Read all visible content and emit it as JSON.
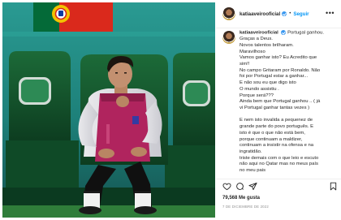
{
  "header": {
    "username": "katiaaveirooficial",
    "dot": "•",
    "follow_label": "Seguir",
    "more_label": "•••"
  },
  "caption": {
    "username": "katiaaveirooficial",
    "first_text": "Portugal ganhou.",
    "lines": [
      "Graças a Deus.",
      "Novos talentos brilharam.",
      "Maravilhoso",
      "Vamos ganhar isto? Eu Acredito que",
      "sim!!",
      "No campo Gritaram por Ronaldo. Não",
      "foi por Portugal estar a ganhar...",
      "E não sou eu que digo isto",
      "O mundo assistiu .",
      "Porque será???",
      "Ainda bem que Portugal ganhou .. ( já",
      "vi Portugal ganhar tantas vezes )",
      "",
      "E nem isto invalida a pequenez de",
      "grande parte do povo português. E",
      "isto é que o que não está bem,",
      "porque continuam a maldizer,",
      "continuam a insistir na ofensa e na",
      "ingratidão.",
      "triste demais com o que leio e escuto",
      "não aqui no Qatar mas no meus país",
      "no meu pais"
    ]
  },
  "icons": {
    "like": "heart-icon",
    "comment": "comment-icon",
    "share": "share-icon",
    "save": "bookmark-icon",
    "verified": "verified-badge-icon"
  },
  "likes_text": "79,568 Me gusta",
  "date_text": "7 DE DICIEMBRE DE 2022",
  "colors": {
    "accent_blue": "#0095f6",
    "verified_blue": "#3897f0",
    "stadium_teal": "#1f8a85",
    "bib_magenta": "#b0245e",
    "flag_green": "#046a38",
    "flag_red": "#da291c"
  }
}
